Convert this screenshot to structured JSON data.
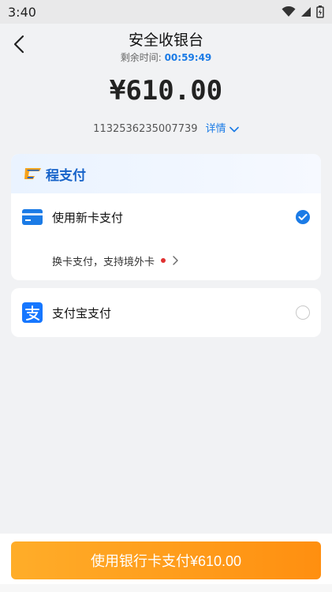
{
  "status_bar": {
    "time": "3:40"
  },
  "header": {
    "title": "安全收银台",
    "countdown_label": "剩余时间:",
    "countdown_value": "00:59:49"
  },
  "amount": "¥610.00",
  "order": {
    "number": "1132536235007739",
    "details_label": "详情"
  },
  "payment_brand": "程支付",
  "methods": [
    {
      "label": "使用新卡支付",
      "icon": "credit-card-icon",
      "selected": true,
      "hint": "换卡支付，支持境外卡"
    },
    {
      "label": "支付宝支付",
      "icon": "alipay-icon",
      "selected": false
    }
  ],
  "pay_button": "使用银行卡支付¥610.00",
  "colors": {
    "accent": "#1b7be6",
    "button": "#ff9a1a",
    "brand": "#1763c9",
    "dot": "#e03131"
  }
}
